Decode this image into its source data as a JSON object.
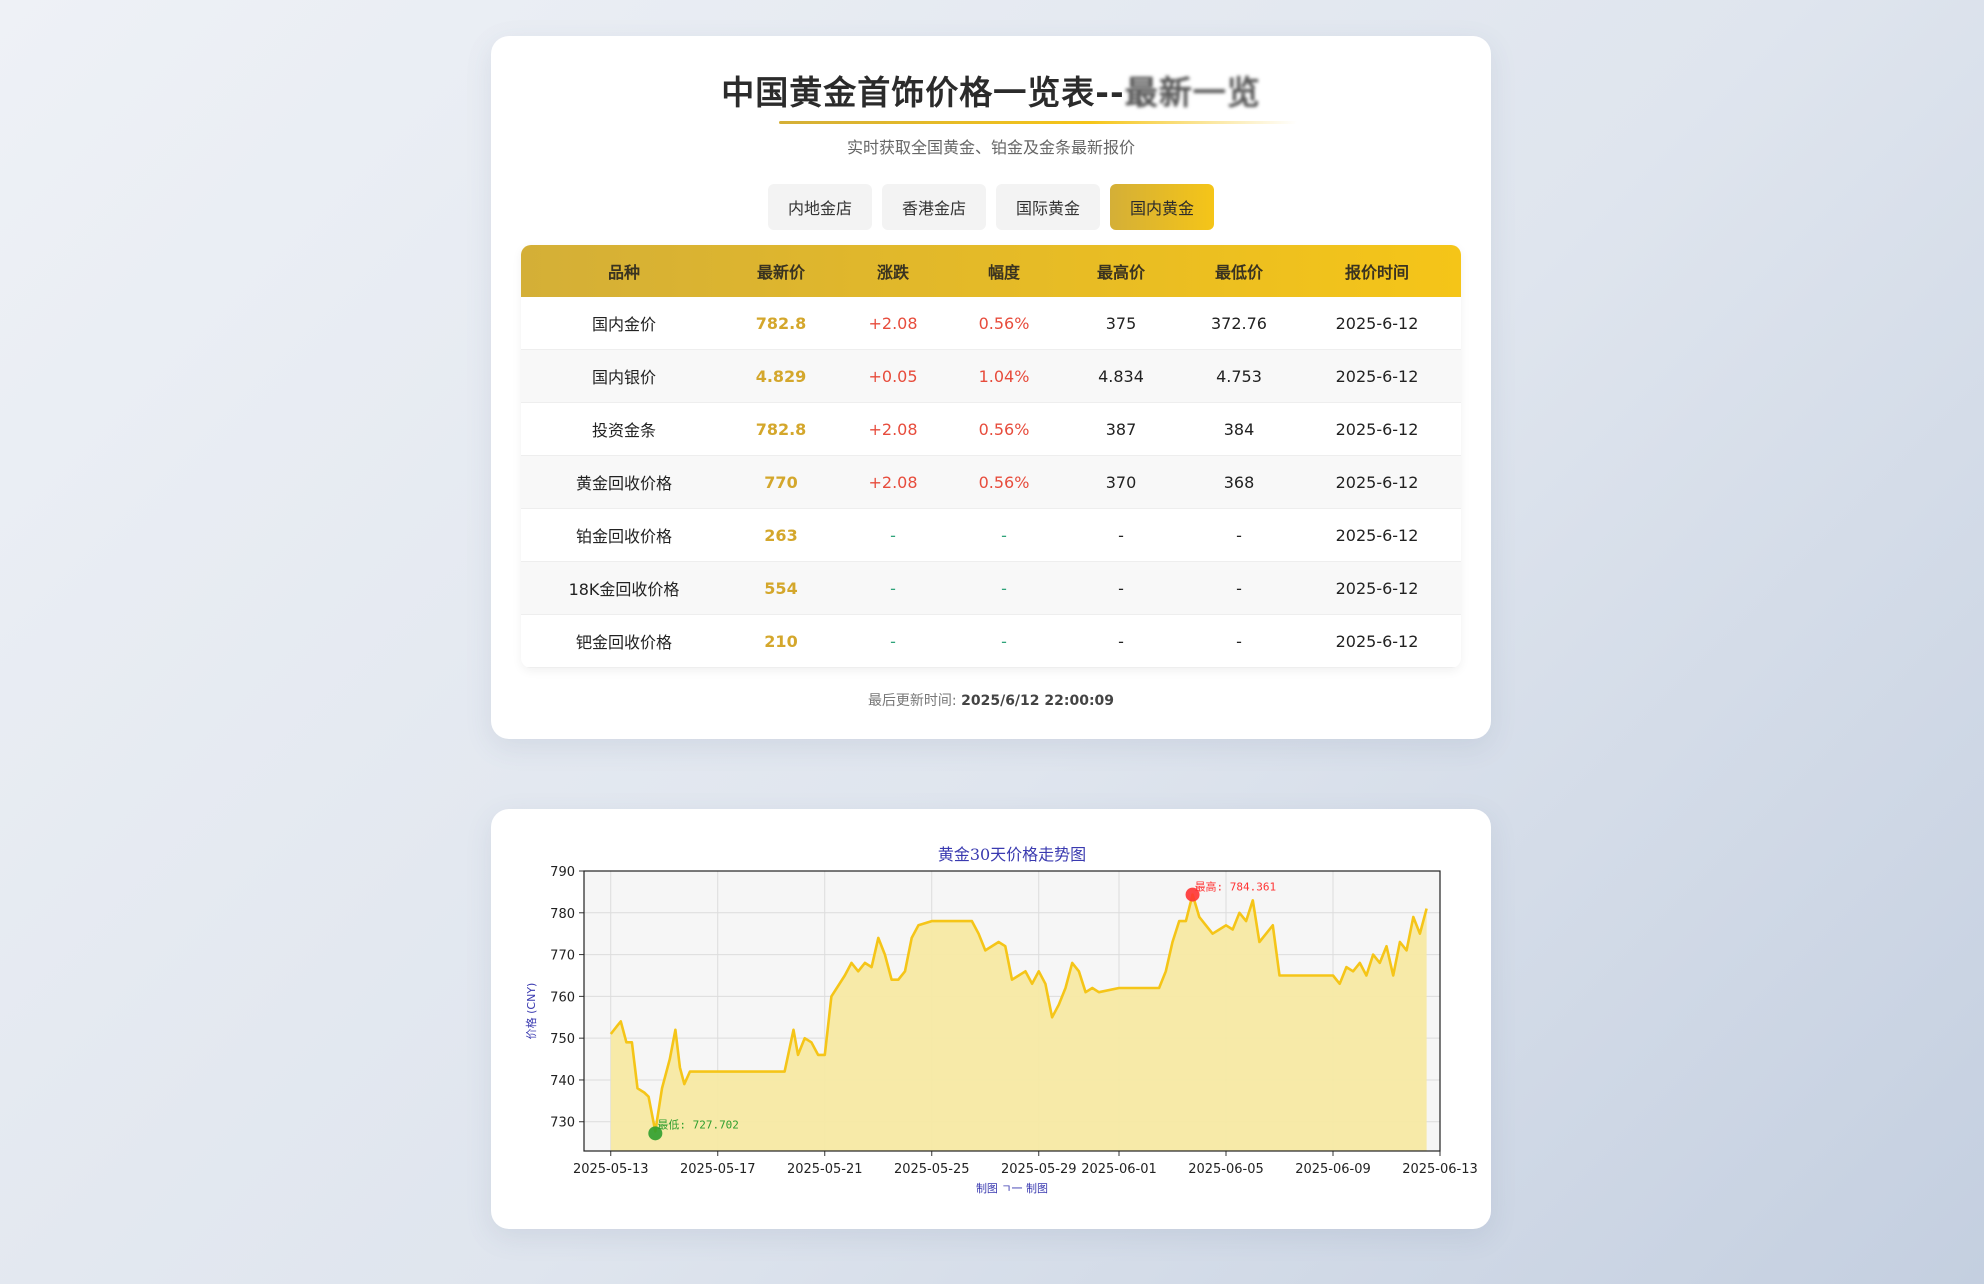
{
  "header": {
    "title_main": "中国黄金首饰价格一览表--",
    "title_suffix": "最新一览",
    "subtitle": "实时获取全国黄金、铂金及金条最新报价"
  },
  "tabs": [
    {
      "label": "内地金店",
      "active": false
    },
    {
      "label": "香港金店",
      "active": false
    },
    {
      "label": "国际黄金",
      "active": false
    },
    {
      "label": "国内黄金",
      "active": true
    }
  ],
  "table": {
    "headers": [
      "品种",
      "最新价",
      "涨跌",
      "幅度",
      "最高价",
      "最低价",
      "报价时间"
    ],
    "rows": [
      [
        "国内金价",
        "782.8",
        "+2.08",
        "0.56%",
        "375",
        "372.76",
        "2025-6-12"
      ],
      [
        "国内银价",
        "4.829",
        "+0.05",
        "1.04%",
        "4.834",
        "4.753",
        "2025-6-12"
      ],
      [
        "投资金条",
        "782.8",
        "+2.08",
        "0.56%",
        "387",
        "384",
        "2025-6-12"
      ],
      [
        "黄金回收价格",
        "770",
        "+2.08",
        "0.56%",
        "370",
        "368",
        "2025-6-12"
      ],
      [
        "铂金回收价格",
        "263",
        "-",
        "-",
        "-",
        "-",
        "2025-6-12"
      ],
      [
        "18K金回收价格",
        "554",
        "-",
        "-",
        "-",
        "-",
        "2025-6-12"
      ],
      [
        "钯金回收价格",
        "210",
        "-",
        "-",
        "-",
        "-",
        "2025-6-12"
      ]
    ]
  },
  "footer": {
    "updated_label": "最后更新时间: ",
    "updated_value": "2025/6/12 22:00:09"
  },
  "colors": {
    "gold": "#d4af37",
    "gold_light": "#f5c518",
    "up": "#e74c3c",
    "flat": "#2fa37a",
    "line": "#f5c518",
    "fill": "#f7e9a3",
    "max": "#ff3333",
    "min": "#2e9e2e"
  },
  "chart_data": {
    "type": "area",
    "title": "黄金30天价格走势图",
    "xlabel": "制图 ㄱ一 制图",
    "ylabel": "价格 (CNY)",
    "ylim": [
      723,
      790
    ],
    "xlim": [
      "2025-05-12",
      "2025-06-13"
    ],
    "y_ticks": [
      730,
      740,
      750,
      760,
      770,
      780,
      790
    ],
    "x_ticks": [
      "2025-05-13",
      "2025-05-17",
      "2025-05-21",
      "2025-05-25",
      "2025-05-29",
      "2025-06-01",
      "2025-06-05",
      "2025-06-09",
      "2025-06-13"
    ],
    "grid": true,
    "series": [
      {
        "points": [
          [
            "2025-05-13 00:00",
            751
          ],
          [
            "2025-05-13 06:00",
            753
          ],
          [
            "2025-05-13 09:00",
            754
          ],
          [
            "2025-05-13 14:00",
            749
          ],
          [
            "2025-05-13 19:00",
            749
          ],
          [
            "2025-05-14 00:00",
            738
          ],
          [
            "2025-05-14 06:00",
            737
          ],
          [
            "2025-05-14 10:00",
            736
          ],
          [
            "2025-05-14 16:00",
            727.7
          ],
          [
            "2025-05-14 22:00",
            738
          ],
          [
            "2025-05-15 05:00",
            745
          ],
          [
            "2025-05-15 10:00",
            752
          ],
          [
            "2025-05-15 14:00",
            743
          ],
          [
            "2025-05-15 18:00",
            739
          ],
          [
            "2025-05-15 23:00",
            742
          ],
          [
            "2025-05-16 06:00",
            742
          ],
          [
            "2025-05-17 00:00",
            742
          ],
          [
            "2025-05-18 00:00",
            742
          ],
          [
            "2025-05-19 12:00",
            742
          ],
          [
            "2025-05-19 20:00",
            752
          ],
          [
            "2025-05-20 00:00",
            746
          ],
          [
            "2025-05-20 06:00",
            750
          ],
          [
            "2025-05-20 12:00",
            749
          ],
          [
            "2025-05-20 18:00",
            746
          ],
          [
            "2025-05-21 00:00",
            746
          ],
          [
            "2025-05-21 06:00",
            760
          ],
          [
            "2025-05-21 18:00",
            765
          ],
          [
            "2025-05-22 00:00",
            768
          ],
          [
            "2025-05-22 06:00",
            766
          ],
          [
            "2025-05-22 12:00",
            768
          ],
          [
            "2025-05-22 18:00",
            767
          ],
          [
            "2025-05-23 00:00",
            774
          ],
          [
            "2025-05-23 06:00",
            770
          ],
          [
            "2025-05-23 12:00",
            764
          ],
          [
            "2025-05-23 18:00",
            764
          ],
          [
            "2025-05-24 00:00",
            766
          ],
          [
            "2025-05-24 06:00",
            774
          ],
          [
            "2025-05-24 12:00",
            777
          ],
          [
            "2025-05-25 00:00",
            778
          ],
          [
            "2025-05-26 00:00",
            778
          ],
          [
            "2025-05-26 12:00",
            778
          ],
          [
            "2025-05-26 18:00",
            775
          ],
          [
            "2025-05-27 00:00",
            771
          ],
          [
            "2025-05-27 12:00",
            773
          ],
          [
            "2025-05-27 18:00",
            772
          ],
          [
            "2025-05-28 00:00",
            764
          ],
          [
            "2025-05-28 06:00",
            765
          ],
          [
            "2025-05-28 12:00",
            766
          ],
          [
            "2025-05-28 18:00",
            763
          ],
          [
            "2025-05-29 00:00",
            766
          ],
          [
            "2025-05-29 06:00",
            763
          ],
          [
            "2025-05-29 12:00",
            755
          ],
          [
            "2025-05-29 18:00",
            758
          ],
          [
            "2025-05-30 00:00",
            762
          ],
          [
            "2025-05-30 06:00",
            768
          ],
          [
            "2025-05-30 12:00",
            766
          ],
          [
            "2025-05-30 18:00",
            761
          ],
          [
            "2025-05-31 00:00",
            762
          ],
          [
            "2025-05-31 06:00",
            761
          ],
          [
            "2025-06-01 00:00",
            762
          ],
          [
            "2025-06-02 00:00",
            762
          ],
          [
            "2025-06-02 12:00",
            762
          ],
          [
            "2025-06-02 18:00",
            766
          ],
          [
            "2025-06-03 00:00",
            773
          ],
          [
            "2025-06-03 06:00",
            778
          ],
          [
            "2025-06-03 12:00",
            778
          ],
          [
            "2025-06-03 18:00",
            784.36
          ],
          [
            "2025-06-04 00:00",
            779
          ],
          [
            "2025-06-04 06:00",
            777
          ],
          [
            "2025-06-04 12:00",
            775
          ],
          [
            "2025-06-04 18:00",
            776
          ],
          [
            "2025-06-05 00:00",
            777
          ],
          [
            "2025-06-05 06:00",
            776
          ],
          [
            "2025-06-05 12:00",
            780
          ],
          [
            "2025-06-05 18:00",
            778
          ],
          [
            "2025-06-06 00:00",
            783
          ],
          [
            "2025-06-06 06:00",
            773
          ],
          [
            "2025-06-06 12:00",
            775
          ],
          [
            "2025-06-06 18:00",
            777
          ],
          [
            "2025-06-07 00:00",
            765
          ],
          [
            "2025-06-08 00:00",
            765
          ],
          [
            "2025-06-09 00:00",
            765
          ],
          [
            "2025-06-09 06:00",
            763
          ],
          [
            "2025-06-09 12:00",
            767
          ],
          [
            "2025-06-09 18:00",
            766
          ],
          [
            "2025-06-10 00:00",
            768
          ],
          [
            "2025-06-10 06:00",
            765
          ],
          [
            "2025-06-10 12:00",
            770
          ],
          [
            "2025-06-10 18:00",
            768
          ],
          [
            "2025-06-11 00:00",
            772
          ],
          [
            "2025-06-11 06:00",
            765
          ],
          [
            "2025-06-11 12:00",
            773
          ],
          [
            "2025-06-11 18:00",
            771
          ],
          [
            "2025-06-12 00:00",
            779
          ],
          [
            "2025-06-12 06:00",
            775
          ],
          [
            "2025-06-12 12:00",
            781
          ]
        ]
      }
    ],
    "annotations": [
      {
        "label": "最高: 784.361",
        "x": "2025-06-03 18:00",
        "y": 784.36,
        "kind": "max"
      },
      {
        "label": "最低: 727.702",
        "x": "2025-05-14 16:00",
        "y": 727.7,
        "kind": "min"
      }
    ]
  }
}
